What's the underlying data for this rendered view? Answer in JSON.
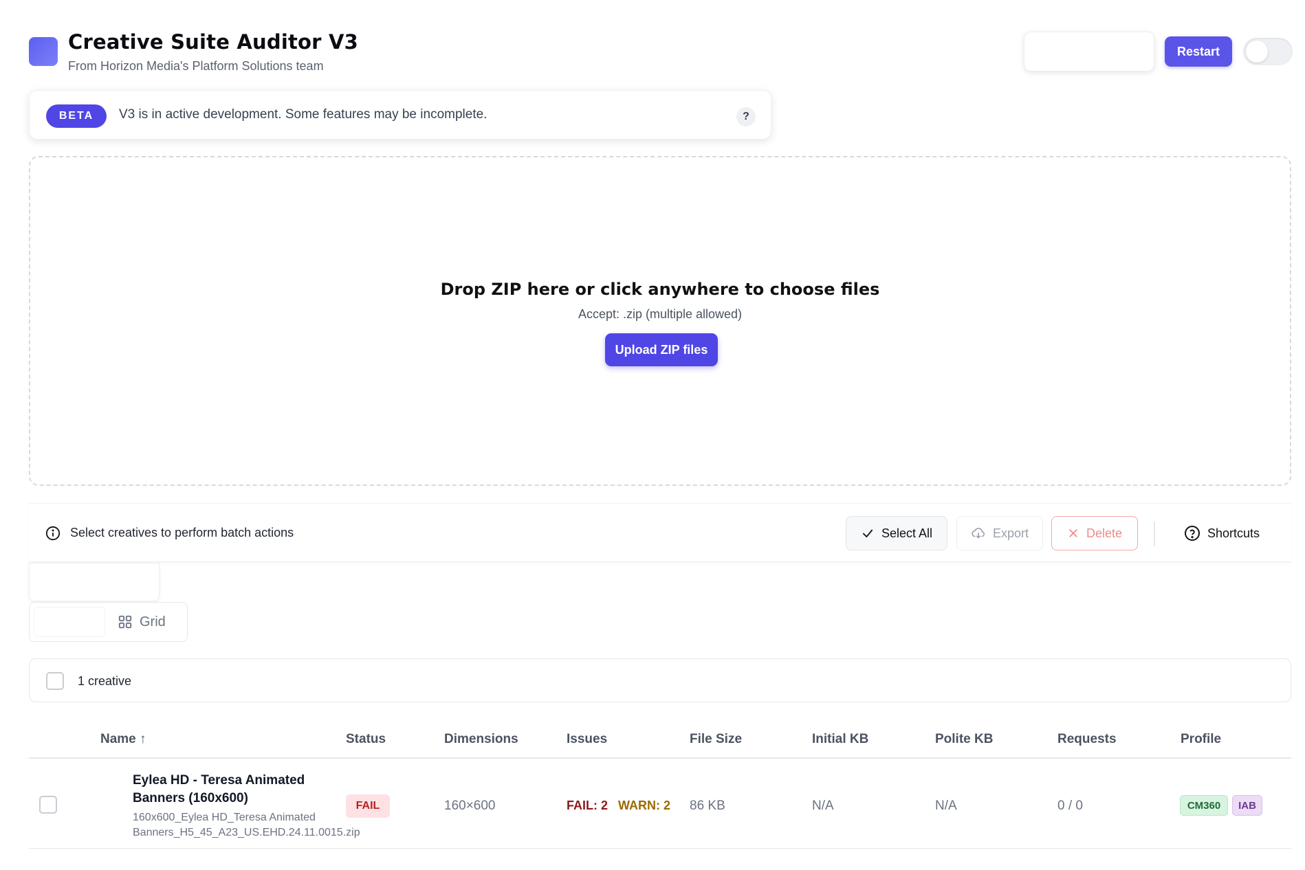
{
  "header": {
    "title": "Creative Suite Auditor V3",
    "subtitle": "From Horizon Media's Platform Solutions team",
    "restart_label": "Restart"
  },
  "beta": {
    "badge": "BETA",
    "message": "V3 is in active development. Some features may be incomplete.",
    "help_glyph": "?"
  },
  "dropzone": {
    "title": "Drop ZIP here or click anywhere to choose files",
    "accept": "Accept: .zip (multiple allowed)",
    "upload_label": "Upload ZIP files"
  },
  "batch": {
    "hint": "Select creatives to perform batch actions",
    "select_all": "Select All",
    "export": "Export",
    "delete": "Delete",
    "shortcuts": "Shortcuts"
  },
  "view": {
    "grid_label": "Grid"
  },
  "list": {
    "count": "1 creative"
  },
  "table": {
    "columns": [
      "Name ↑",
      "Status",
      "Dimensions",
      "Issues",
      "File Size",
      "Initial KB",
      "Polite KB",
      "Requests",
      "Profile"
    ],
    "rows": [
      {
        "name": "Eylea HD - Teresa Animated Banners (160x600)",
        "file": "160x600_Eylea HD_Teresa Animated Banners_H5_45_A23_US.EHD.24.11.0015.zip",
        "status": "FAIL",
        "dimensions": "160×600",
        "issues_fail": "FAIL: 2",
        "issues_warn": "WARN: 2",
        "file_size": "86 KB",
        "initial_kb": "N/A",
        "polite_kb": "N/A",
        "requests": "0 / 0",
        "profiles": [
          "CM360",
          "IAB"
        ]
      }
    ]
  },
  "colors": {
    "accent": "#4f46e5",
    "fail": "#b42323",
    "warn": "#9a6a00"
  }
}
